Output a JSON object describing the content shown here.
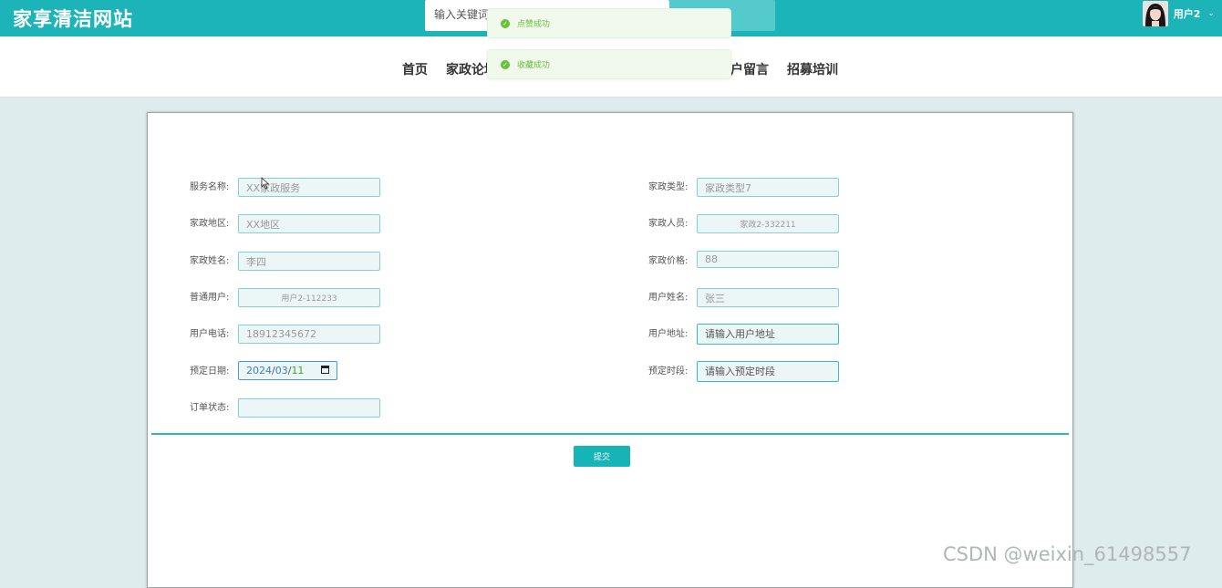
{
  "site": {
    "title": "家享清洁网站"
  },
  "search": {
    "placeholder": "输入关键词"
  },
  "user": {
    "name": "用户2"
  },
  "nav": {
    "items": [
      "首页",
      "家政论坛",
      "户留言",
      "招募培训"
    ]
  },
  "toasts": [
    {
      "text": "点赞成功"
    },
    {
      "text": "收藏成功"
    }
  ],
  "form": {
    "service_name": {
      "label": "服务名称:",
      "value": "XX家政服务"
    },
    "service_type": {
      "label": "家政类型:",
      "value": "家政类型7"
    },
    "region": {
      "label": "家政地区:",
      "value": "XX地区"
    },
    "staff": {
      "label": "家政人员:",
      "value": "家政2-332211"
    },
    "staff_name": {
      "label": "家政姓名:",
      "value": "李四"
    },
    "price": {
      "label": "家政价格:",
      "value": "88"
    },
    "user_account": {
      "label": "普通用户:",
      "value": "用户2-112233"
    },
    "user_name": {
      "label": "用户姓名:",
      "value": "张三"
    },
    "phone": {
      "label": "用户电话:",
      "value": "18912345672"
    },
    "address": {
      "label": "用户地址:",
      "placeholder": "请输入用户地址"
    },
    "date": {
      "label": "预定日期:",
      "year": "2024",
      "month": "03",
      "day": "11"
    },
    "time_slot": {
      "label": "预定时段:",
      "placeholder": "请输入预定时段"
    },
    "order_status": {
      "label": "订单状态:",
      "value": ""
    },
    "submit_label": "提交"
  },
  "watermark": "CSDN @weixin_61498557",
  "colors": {
    "primary": "#1cb4b8",
    "success": "#67c23a",
    "page_bg": "#dfeced"
  }
}
